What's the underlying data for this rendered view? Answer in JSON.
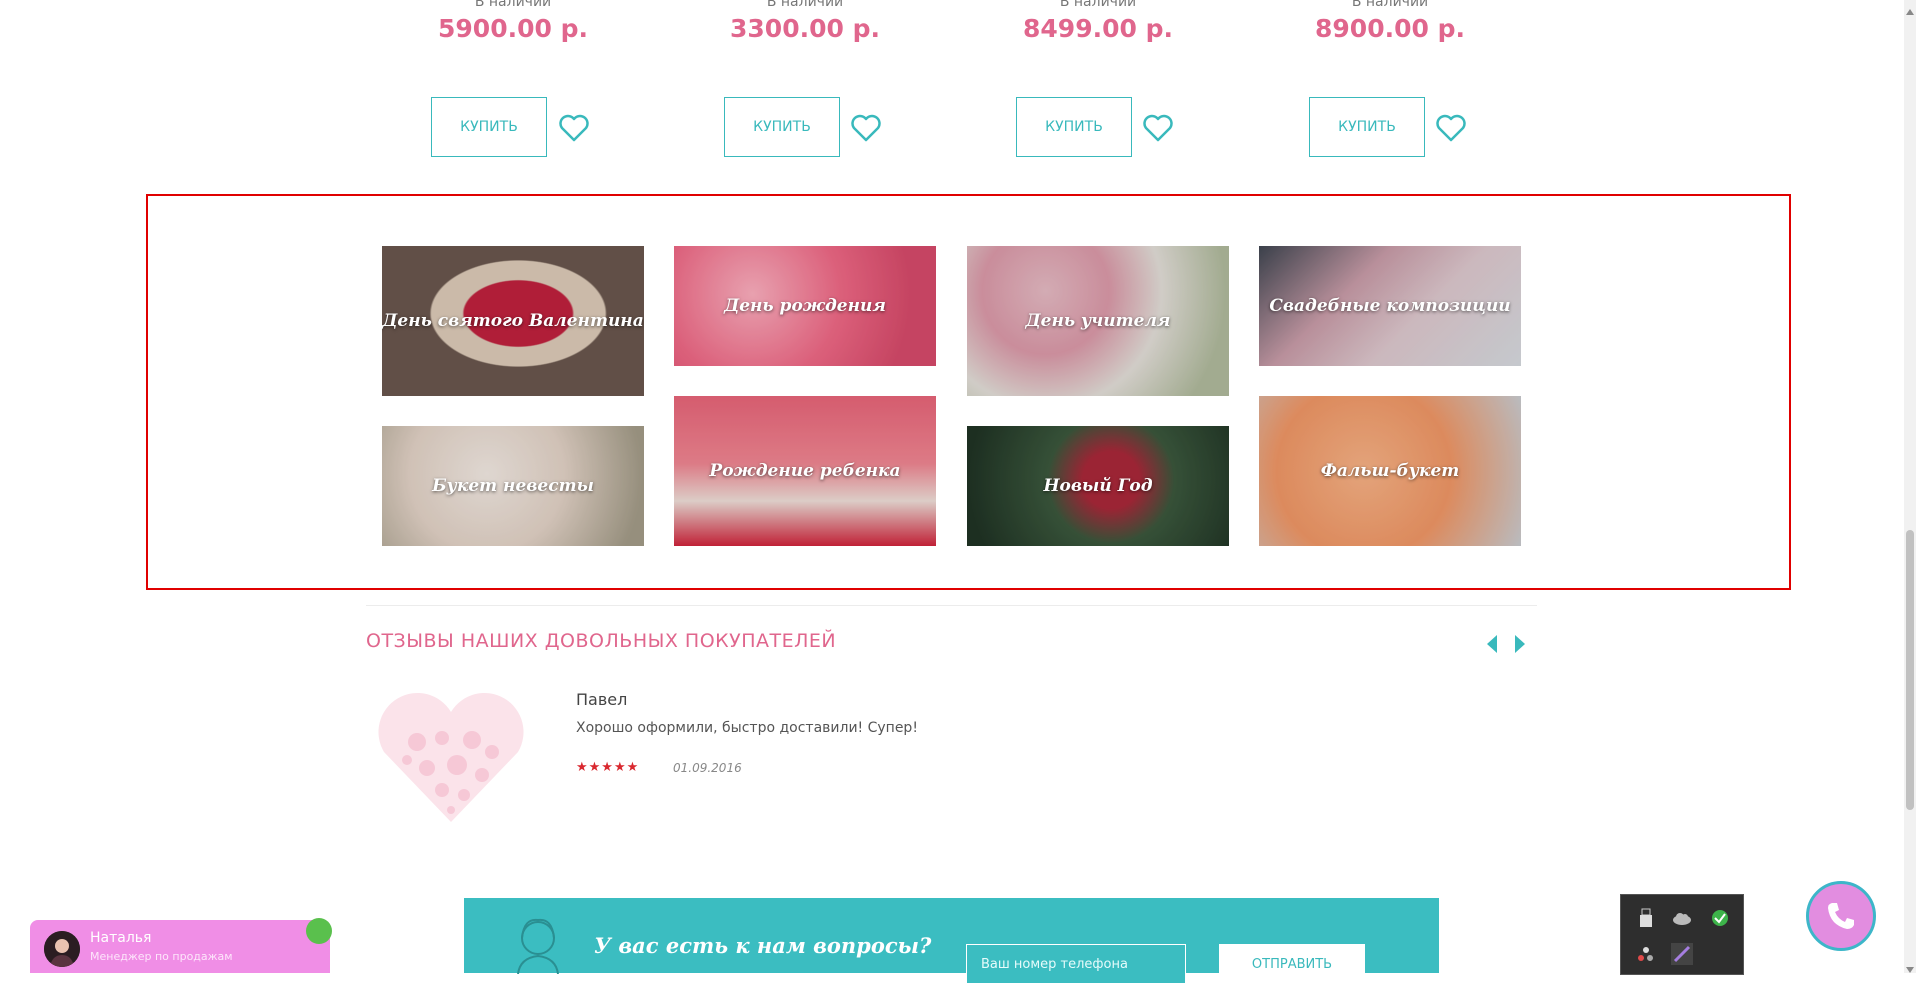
{
  "products": [
    {
      "stock": "В наличии",
      "price": "5900.00 р.",
      "buy_label": "КУПИТЬ"
    },
    {
      "stock": "В наличии",
      "price": "3300.00 р.",
      "buy_label": "КУПИТЬ"
    },
    {
      "stock": "В наличии",
      "price": "8499.00 р.",
      "buy_label": "КУПИТЬ"
    },
    {
      "stock": "В наличии",
      "price": "8900.00 р.",
      "buy_label": "КУПИТЬ"
    }
  ],
  "categories": [
    {
      "label": "День святого Валентина"
    },
    {
      "label": "День рождения"
    },
    {
      "label": "День учителя"
    },
    {
      "label": "Свадебные композиции"
    },
    {
      "label": "Букет невесты"
    },
    {
      "label": "Рождение ребенка"
    },
    {
      "label": "Новый Год"
    },
    {
      "label": "Фальш-букет"
    }
  ],
  "reviews": {
    "title": "ОТЗЫВЫ НАШИХ ДОВОЛЬНЫХ ПОКУПАТЕЛЕЙ",
    "items": [
      {
        "name": "Павел",
        "text": "Хорошо оформили, быстро доставили! Супер!",
        "stars": "★★★★★",
        "rating": 5,
        "date": "01.09.2016"
      }
    ]
  },
  "question": {
    "title": "У вас есть к нам вопросы?",
    "phone_placeholder": "Ваш номер телефона",
    "send_label": "ОТПРАВИТЬ"
  },
  "chat": {
    "name": "Наталья",
    "role": "Менеджер по продажам"
  },
  "colors": {
    "accent": "#39b9bc",
    "price": "#e0668d",
    "highlight": "#e00000",
    "chat": "#f08ee6"
  }
}
